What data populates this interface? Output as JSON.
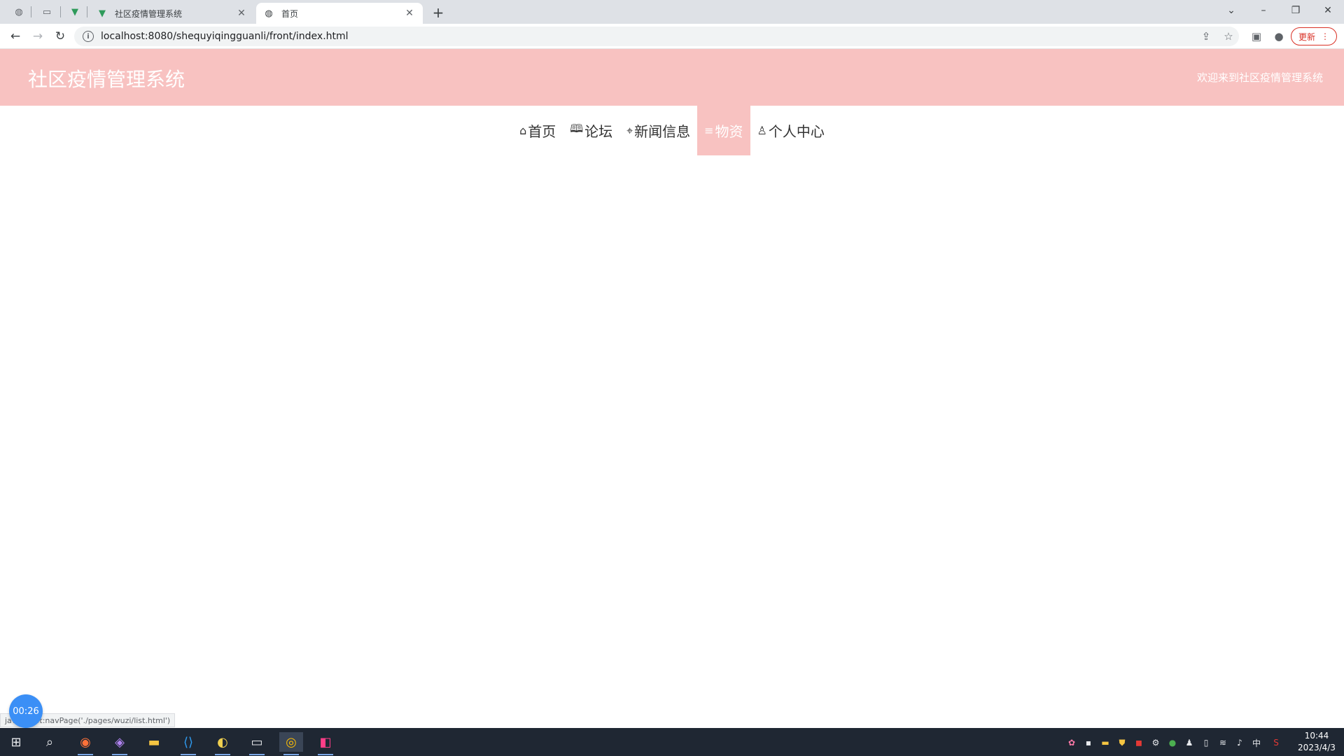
{
  "browser": {
    "tabs": [
      {
        "title": "社区疫情管理系统",
        "active": false
      },
      {
        "title": "首页",
        "active": true
      }
    ],
    "new_tab": "+",
    "address": "localhost:8080/shequyiqingguanli/front/index.html",
    "update_label": "更新",
    "status_link": "javascript:navPage('./pages/wuzi/list.html')"
  },
  "site": {
    "title": "社区疫情管理系统",
    "welcome": "欢迎来到社区疫情管理系统",
    "nav": [
      {
        "label": "首页",
        "icon": "home-icon",
        "glyph": "⌂"
      },
      {
        "label": "论坛",
        "icon": "book-icon",
        "glyph": "🕮"
      },
      {
        "label": "新闻信息",
        "icon": "tag-icon",
        "glyph": "⌖"
      },
      {
        "label": "物资",
        "icon": "list-icon",
        "glyph": "≡",
        "active": true
      },
      {
        "label": "个人中心",
        "icon": "user-icon",
        "glyph": "♙"
      }
    ]
  },
  "timer": "00:26",
  "taskbar": {
    "time": "10:44",
    "date": "2023/4/3",
    "ime": "中"
  },
  "colors": {
    "header_bg": "#f8c2c1",
    "taskbar_bg": "#1f2733",
    "timer_bg": "#3b8ff6"
  }
}
